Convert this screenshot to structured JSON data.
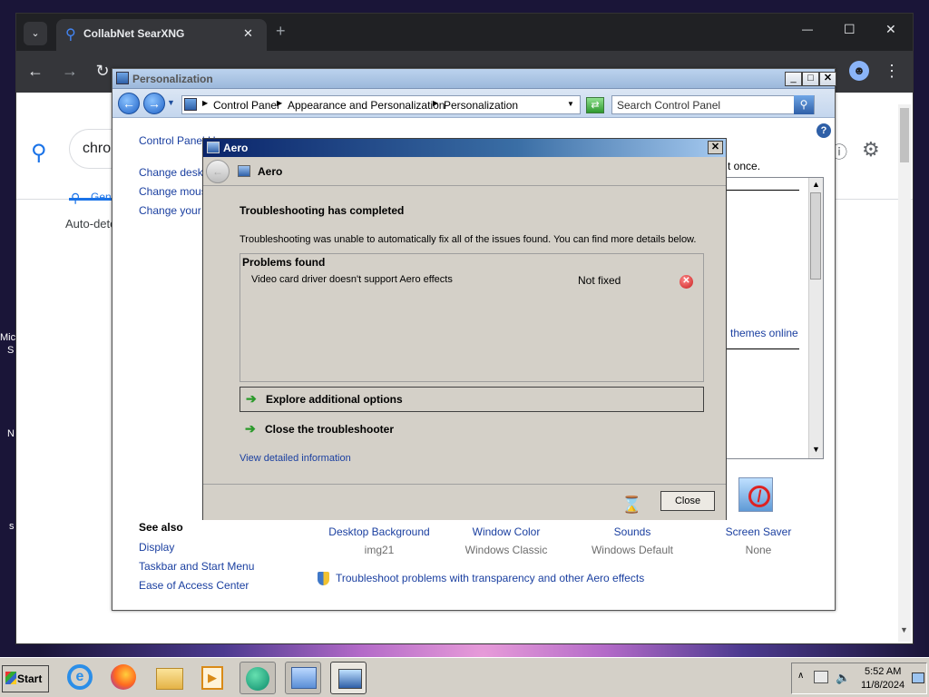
{
  "desktop": {
    "frag_1": "Mic",
    "frag_2": "S",
    "frag_3": "N",
    "frag_4": "s"
  },
  "chrome": {
    "tab_title": "CollabNet SearXNG",
    "tab_close": "✕",
    "new_tab": "+",
    "window_min": "—",
    "window_max": "☐",
    "window_close": "✕",
    "search_value": "chro",
    "tab_general": "Gen",
    "autodetect": "Auto-dete"
  },
  "personalization": {
    "title": "Personalization",
    "breadcrumb": [
      "Control Panel",
      "Appearance and Personalization",
      "Personalization"
    ],
    "search_placeholder": "Search Control Panel",
    "left_links": [
      "Control Panel H",
      "Change deskto",
      "Change mouse",
      "Change your a"
    ],
    "right_text": "t once.",
    "themes_link": "themes online",
    "see_also_title": "See also",
    "see_also": [
      "Display",
      "Taskbar and Start Menu",
      "Ease of Access Center"
    ],
    "bottom_items": [
      {
        "label": "Desktop Background",
        "value": "img21"
      },
      {
        "label": "Window Color",
        "value": "Windows Classic"
      },
      {
        "label": "Sounds",
        "value": "Windows Default"
      },
      {
        "label": "Screen Saver",
        "value": "None"
      }
    ],
    "troubleshoot_link": "Troubleshoot problems with transparency and other Aero effects"
  },
  "aero": {
    "title": "Aero",
    "header_label": "Aero",
    "heading": "Troubleshooting has completed",
    "description": "Troubleshooting was unable to automatically fix all of the issues found. You can find more details below.",
    "problems_title": "Problems found",
    "problem": "Video card driver doesn't support Aero effects",
    "problem_status": "Not fixed",
    "explore_label": "Explore additional options",
    "close_troubleshooter_label": "Close the troubleshooter",
    "detail_link": "View detailed information",
    "close_button": "Close"
  },
  "taskbar": {
    "start_label": "Start",
    "time": "5:52 AM",
    "date": "11/8/2024"
  },
  "colors": {
    "link": "#1a3fa0",
    "error": "#d42a2a",
    "chrome_dark": "#202124"
  }
}
